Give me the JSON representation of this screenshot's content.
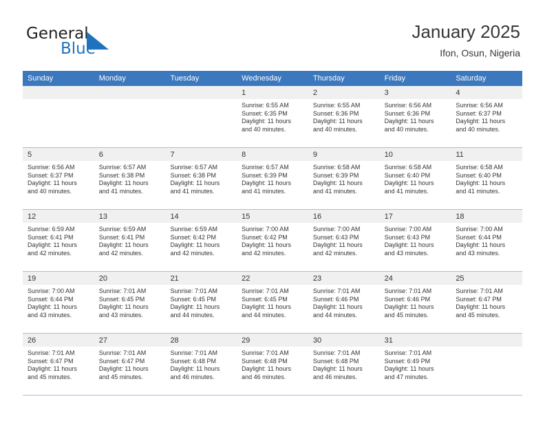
{
  "brand": {
    "name_part1": "General",
    "name_part2": "Blue",
    "logo_icon": "blue-triangle-icon",
    "accent_color": "#1f72bd"
  },
  "header": {
    "title": "January 2025",
    "subtitle": "Ifon, Osun, Nigeria"
  },
  "colors": {
    "header_row_bg": "#3b78bd",
    "header_row_text": "#ffffff",
    "daynum_band_bg": "#f0f0f0",
    "grid_line": "#a8bedd",
    "text": "#333333"
  },
  "weekdays": [
    "Sunday",
    "Monday",
    "Tuesday",
    "Wednesday",
    "Thursday",
    "Friday",
    "Saturday"
  ],
  "weeks": [
    [
      {
        "day": "",
        "lines": []
      },
      {
        "day": "",
        "lines": []
      },
      {
        "day": "",
        "lines": []
      },
      {
        "day": "1",
        "lines": [
          "Sunrise: 6:55 AM",
          "Sunset: 6:35 PM",
          "Daylight: 11 hours",
          "and 40 minutes."
        ]
      },
      {
        "day": "2",
        "lines": [
          "Sunrise: 6:55 AM",
          "Sunset: 6:36 PM",
          "Daylight: 11 hours",
          "and 40 minutes."
        ]
      },
      {
        "day": "3",
        "lines": [
          "Sunrise: 6:56 AM",
          "Sunset: 6:36 PM",
          "Daylight: 11 hours",
          "and 40 minutes."
        ]
      },
      {
        "day": "4",
        "lines": [
          "Sunrise: 6:56 AM",
          "Sunset: 6:37 PM",
          "Daylight: 11 hours",
          "and 40 minutes."
        ]
      }
    ],
    [
      {
        "day": "5",
        "lines": [
          "Sunrise: 6:56 AM",
          "Sunset: 6:37 PM",
          "Daylight: 11 hours",
          "and 40 minutes."
        ]
      },
      {
        "day": "6",
        "lines": [
          "Sunrise: 6:57 AM",
          "Sunset: 6:38 PM",
          "Daylight: 11 hours",
          "and 41 minutes."
        ]
      },
      {
        "day": "7",
        "lines": [
          "Sunrise: 6:57 AM",
          "Sunset: 6:38 PM",
          "Daylight: 11 hours",
          "and 41 minutes."
        ]
      },
      {
        "day": "8",
        "lines": [
          "Sunrise: 6:57 AM",
          "Sunset: 6:39 PM",
          "Daylight: 11 hours",
          "and 41 minutes."
        ]
      },
      {
        "day": "9",
        "lines": [
          "Sunrise: 6:58 AM",
          "Sunset: 6:39 PM",
          "Daylight: 11 hours",
          "and 41 minutes."
        ]
      },
      {
        "day": "10",
        "lines": [
          "Sunrise: 6:58 AM",
          "Sunset: 6:40 PM",
          "Daylight: 11 hours",
          "and 41 minutes."
        ]
      },
      {
        "day": "11",
        "lines": [
          "Sunrise: 6:58 AM",
          "Sunset: 6:40 PM",
          "Daylight: 11 hours",
          "and 41 minutes."
        ]
      }
    ],
    [
      {
        "day": "12",
        "lines": [
          "Sunrise: 6:59 AM",
          "Sunset: 6:41 PM",
          "Daylight: 11 hours",
          "and 42 minutes."
        ]
      },
      {
        "day": "13",
        "lines": [
          "Sunrise: 6:59 AM",
          "Sunset: 6:41 PM",
          "Daylight: 11 hours",
          "and 42 minutes."
        ]
      },
      {
        "day": "14",
        "lines": [
          "Sunrise: 6:59 AM",
          "Sunset: 6:42 PM",
          "Daylight: 11 hours",
          "and 42 minutes."
        ]
      },
      {
        "day": "15",
        "lines": [
          "Sunrise: 7:00 AM",
          "Sunset: 6:42 PM",
          "Daylight: 11 hours",
          "and 42 minutes."
        ]
      },
      {
        "day": "16",
        "lines": [
          "Sunrise: 7:00 AM",
          "Sunset: 6:43 PM",
          "Daylight: 11 hours",
          "and 42 minutes."
        ]
      },
      {
        "day": "17",
        "lines": [
          "Sunrise: 7:00 AM",
          "Sunset: 6:43 PM",
          "Daylight: 11 hours",
          "and 43 minutes."
        ]
      },
      {
        "day": "18",
        "lines": [
          "Sunrise: 7:00 AM",
          "Sunset: 6:44 PM",
          "Daylight: 11 hours",
          "and 43 minutes."
        ]
      }
    ],
    [
      {
        "day": "19",
        "lines": [
          "Sunrise: 7:00 AM",
          "Sunset: 6:44 PM",
          "Daylight: 11 hours",
          "and 43 minutes."
        ]
      },
      {
        "day": "20",
        "lines": [
          "Sunrise: 7:01 AM",
          "Sunset: 6:45 PM",
          "Daylight: 11 hours",
          "and 43 minutes."
        ]
      },
      {
        "day": "21",
        "lines": [
          "Sunrise: 7:01 AM",
          "Sunset: 6:45 PM",
          "Daylight: 11 hours",
          "and 44 minutes."
        ]
      },
      {
        "day": "22",
        "lines": [
          "Sunrise: 7:01 AM",
          "Sunset: 6:45 PM",
          "Daylight: 11 hours",
          "and 44 minutes."
        ]
      },
      {
        "day": "23",
        "lines": [
          "Sunrise: 7:01 AM",
          "Sunset: 6:46 PM",
          "Daylight: 11 hours",
          "and 44 minutes."
        ]
      },
      {
        "day": "24",
        "lines": [
          "Sunrise: 7:01 AM",
          "Sunset: 6:46 PM",
          "Daylight: 11 hours",
          "and 45 minutes."
        ]
      },
      {
        "day": "25",
        "lines": [
          "Sunrise: 7:01 AM",
          "Sunset: 6:47 PM",
          "Daylight: 11 hours",
          "and 45 minutes."
        ]
      }
    ],
    [
      {
        "day": "26",
        "lines": [
          "Sunrise: 7:01 AM",
          "Sunset: 6:47 PM",
          "Daylight: 11 hours",
          "and 45 minutes."
        ]
      },
      {
        "day": "27",
        "lines": [
          "Sunrise: 7:01 AM",
          "Sunset: 6:47 PM",
          "Daylight: 11 hours",
          "and 45 minutes."
        ]
      },
      {
        "day": "28",
        "lines": [
          "Sunrise: 7:01 AM",
          "Sunset: 6:48 PM",
          "Daylight: 11 hours",
          "and 46 minutes."
        ]
      },
      {
        "day": "29",
        "lines": [
          "Sunrise: 7:01 AM",
          "Sunset: 6:48 PM",
          "Daylight: 11 hours",
          "and 46 minutes."
        ]
      },
      {
        "day": "30",
        "lines": [
          "Sunrise: 7:01 AM",
          "Sunset: 6:48 PM",
          "Daylight: 11 hours",
          "and 46 minutes."
        ]
      },
      {
        "day": "31",
        "lines": [
          "Sunrise: 7:01 AM",
          "Sunset: 6:49 PM",
          "Daylight: 11 hours",
          "and 47 minutes."
        ]
      },
      {
        "day": "",
        "lines": []
      }
    ]
  ]
}
